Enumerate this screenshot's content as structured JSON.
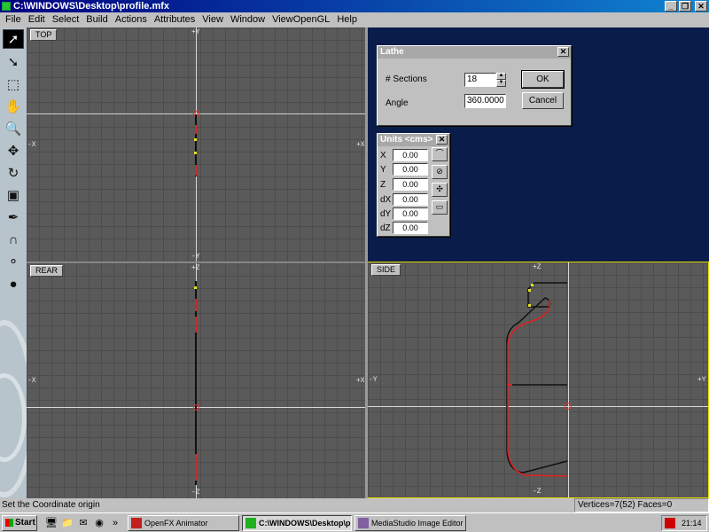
{
  "window": {
    "title": "C:\\WINDOWS\\Desktop\\profile.mfx",
    "minimize_glyph": "_",
    "restore_glyph": "❐",
    "close_glyph": "✕"
  },
  "menu": [
    "File",
    "Edit",
    "Select",
    "Build",
    "Actions",
    "Attributes",
    "View",
    "Window",
    "ViewOpenGL",
    "Help"
  ],
  "viewports": {
    "top": {
      "label": "TOP",
      "axis_top": "+Y",
      "axis_bottom": "-Y",
      "axis_left": "-X",
      "axis_right": "+X"
    },
    "rear": {
      "label": "REAR",
      "axis_top": "+Z",
      "axis_bottom": "-Z",
      "axis_left": "-X",
      "axis_right": "+X"
    },
    "side": {
      "label": "SIDE",
      "axis_top": "+Z",
      "axis_bottom": "-Z",
      "axis_left": "-Y",
      "axis_right": "+Y"
    }
  },
  "lathe_dialog": {
    "title": "Lathe",
    "close_glyph": "✕",
    "sections_label": "# Sections",
    "sections_value": "18",
    "angle_label": "Angle",
    "angle_value": "360.0000",
    "ok_label": "OK",
    "cancel_label": "Cancel"
  },
  "units_dialog": {
    "title": "Units <cms>",
    "close_glyph": "✕",
    "rows": [
      {
        "label": "X",
        "value": "0.00"
      },
      {
        "label": "Y",
        "value": "0.00"
      },
      {
        "label": "Z",
        "value": "0.00"
      },
      {
        "label": "dX",
        "value": "0.00"
      },
      {
        "label": "dY",
        "value": "0.00"
      },
      {
        "label": "dZ",
        "value": "0.00"
      }
    ]
  },
  "status": {
    "message": "Set the Coordinate origin",
    "counts": "Vertices=7(52) Faces=0"
  },
  "taskbar": {
    "start_label": "Start",
    "tasks": [
      "OpenFX Animator",
      "C:\\WINDOWS\\Desktop\\p...",
      "MediaStudio Image Editor"
    ],
    "overflow_glyph": "»",
    "clock": "21:14"
  },
  "colors": {
    "title_bar": "#000080",
    "viewport_bg": "#5a5a5a",
    "blue_area": "#0a1d4a",
    "profile_red": "#e02020",
    "vertex_yellow": "#e0e020",
    "active_border": "#e8e000"
  },
  "icons": {
    "tools": [
      "arrow-pointer-icon",
      "arrow-select-icon",
      "box-select-icon",
      "hand-pan-icon",
      "zoom-icon",
      "move-icon",
      "rotate-icon",
      "frame-icon",
      "pen-icon",
      "magnet-icon",
      "spheres-icon",
      "ball-icon"
    ]
  }
}
